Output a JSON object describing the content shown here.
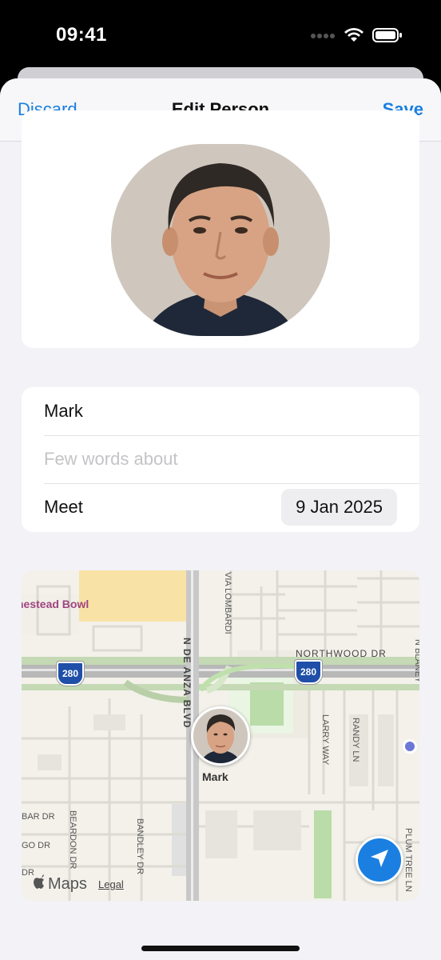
{
  "status": {
    "time": "09:41"
  },
  "nav": {
    "discard_label": "Discard",
    "title": "Edit Person",
    "save_label": "Save"
  },
  "form": {
    "name_value": "Mark",
    "about_placeholder": "Few words about",
    "meet_label": "Meet",
    "meet_date": "9 Jan 2025"
  },
  "map": {
    "poi": "nestead Bowl",
    "streets": [
      "N DE ANZA BLVD",
      "VIA LOMBARDI",
      "NORTHWOOD DR",
      "N BLANEY",
      "LARRY WAY",
      "RANDY LN",
      "BEARDON DR",
      "BANDLEY DR",
      "PLUM TREE LN",
      "BAR DR",
      "GO DR",
      "DR"
    ],
    "shields": [
      "280",
      "280"
    ],
    "pin_label": "Mark",
    "brand": "Maps",
    "legal": "Legal"
  },
  "colors": {
    "accent": "#1a7fe0",
    "background": "#f2f2f7"
  }
}
